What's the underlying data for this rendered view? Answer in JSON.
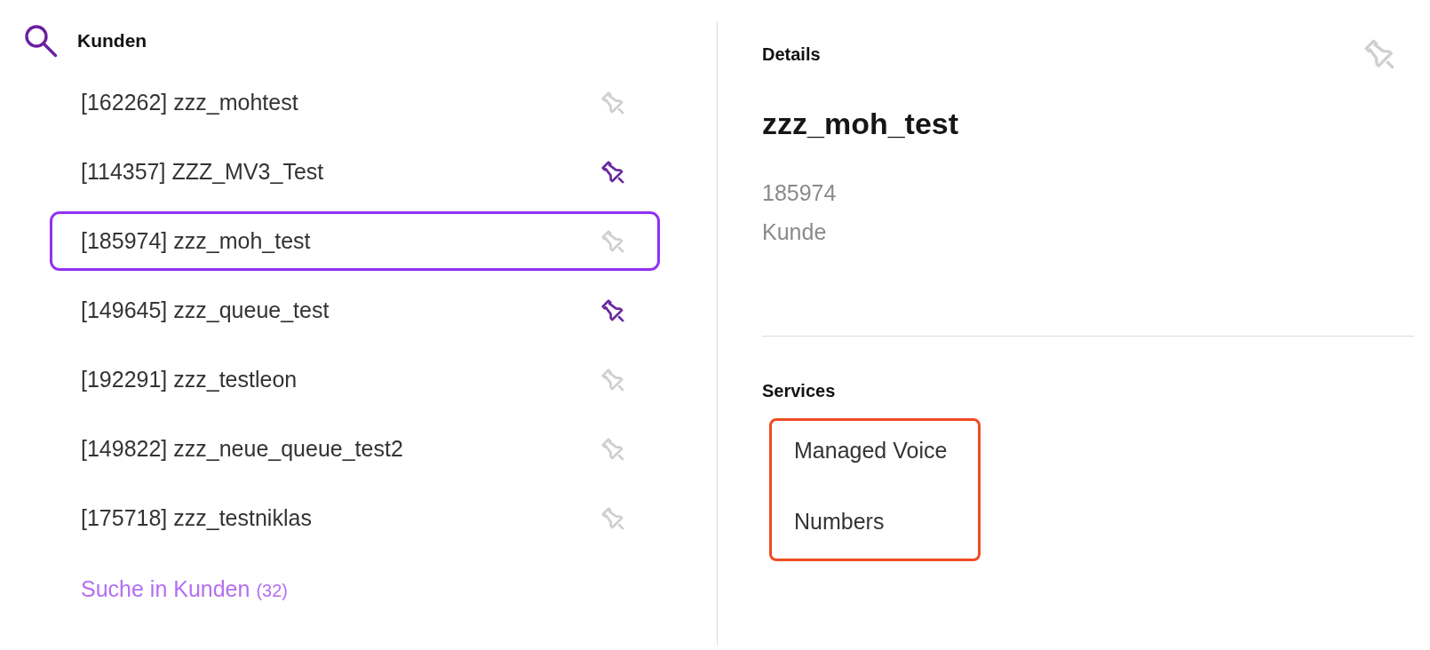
{
  "search": {
    "title": "Kunden"
  },
  "customers": [
    {
      "label": "[162262] zzz_mohtest",
      "pinned": false,
      "selected": false
    },
    {
      "label": "[114357] ZZZ_MV3_Test",
      "pinned": true,
      "selected": false
    },
    {
      "label": "[185974] zzz_moh_test",
      "pinned": false,
      "selected": true
    },
    {
      "label": "[149645] zzz_queue_test",
      "pinned": true,
      "selected": false
    },
    {
      "label": "[192291] zzz_testleon",
      "pinned": false,
      "selected": false
    },
    {
      "label": "[149822] zzz_neue_queue_test2",
      "pinned": false,
      "selected": false
    },
    {
      "label": "[175718] zzz_testniklas",
      "pinned": false,
      "selected": false
    }
  ],
  "more_link": {
    "label": "Suche in Kunden",
    "count": "(32)"
  },
  "details": {
    "heading": "Details",
    "pinned": false,
    "name": "zzz_moh_test",
    "number": "185974",
    "type": "Kunde"
  },
  "services": {
    "heading": "Services",
    "highlighted": true,
    "items": [
      "Managed Voice",
      "Numbers"
    ]
  }
}
